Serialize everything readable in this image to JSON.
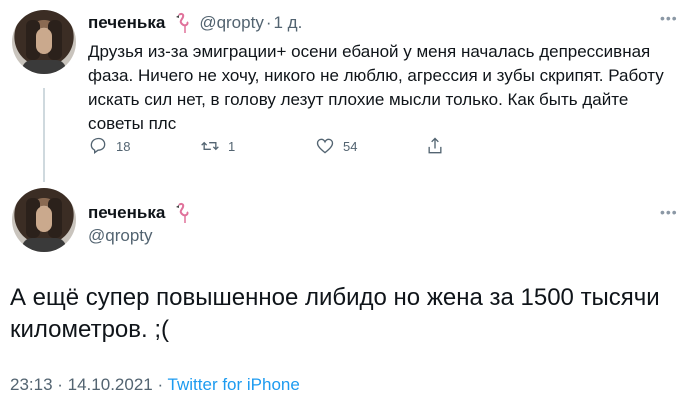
{
  "tweet1": {
    "display_name": "печенька",
    "handle": "@qropty",
    "separator": "·",
    "time": "1 д.",
    "text": "Друзья из-за эмиграции+ осени ебаной у меня началась депрессивная фаза. Ничего не хочу, никого не люблю, агрессия и зубы скрипят. Работу искать сил нет, в голову лезут плохие мысли только. Как быть дайте советы плс",
    "replies": "18",
    "retweets": "1",
    "likes": "54",
    "more": "•••"
  },
  "tweet2": {
    "display_name": "печенька",
    "handle": "@qropty",
    "text": "А ещё супер повышенное либидо но жена за 1500 тысячи километров. ;(",
    "more": "•••",
    "timestamp": "23:13 · 14.10.2021 ·",
    "source": "Twitter for iPhone"
  },
  "colors": {
    "text": "#0f1419",
    "secondary": "#536471",
    "link": "#1d9bf0",
    "line": "#cfd9de"
  },
  "icons": [
    "flamingo-icon",
    "reply-icon",
    "retweet-icon",
    "like-icon",
    "share-icon",
    "more-icon"
  ]
}
